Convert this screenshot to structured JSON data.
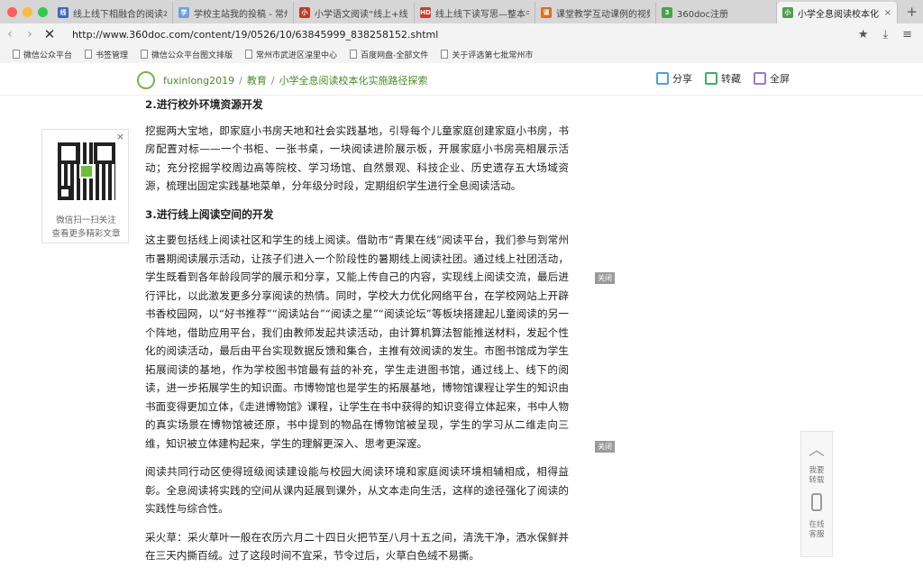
{
  "tabs": [
    {
      "label": "线上线下相融合的阅读本",
      "fav_color": "#3a66c4",
      "fav": "线"
    },
    {
      "label": "学校主站我的投稿 - 常州",
      "fav_color": "#6aa0e0",
      "fav": "学"
    },
    {
      "label": "小学语文阅读“线上+线下",
      "fav_color": "#c0392b",
      "fav": "小"
    },
    {
      "label": "线上线下读写思—整本书",
      "fav_color": "#d23a2b",
      "fav": "HD"
    },
    {
      "label": "课堂教学互动课例的视频",
      "fav_color": "#e06a1c",
      "fav": "课"
    },
    {
      "label": "360doc注册",
      "fav_color": "#4aa24a",
      "fav": "3"
    },
    {
      "label": "小学全息阅读校本化实施",
      "fav_color": "#4aa24a",
      "fav": "小",
      "close": "×"
    }
  ],
  "browser": {
    "url": "http://www.360doc.com/content/19/0526/10/63845999_838258152.shtml",
    "new_tab": "+"
  },
  "bookmarks": [
    "微信公众平台",
    "书签管理",
    "微信公众平台图文排版",
    "常州市武进区湟里中心",
    "百度网盘-全部文件",
    "关于评选第七批常州市"
  ],
  "site": {
    "user": "fuxinlong2019",
    "sep": "/",
    "category": "教育",
    "title": "小学全息阅读校本化实施路径探索",
    "share": "分享",
    "collect": "转藏",
    "fullscreen": "全屏"
  },
  "qr": {
    "close": "×",
    "line1": "微信扫一扫关注",
    "line2": "查看更多精彩文章"
  },
  "article": {
    "h1": "2.进行校外环境资源开发",
    "p1": "挖掘两大宝地，即家庭小书房天地和社会实践基地，引导每个儿童家庭创建家庭小书房，书房配置对标——一个书柜、一张书桌，一块阅读进阶展示板，开展家庭小书房亮相展示活动；充分挖掘学校周边高等院校、学习场馆、自然景观、科技企业、历史遗存五大场域资源，梳理出固定实践基地菜单，分年级分时段，定期组织学生进行全息阅读活动。",
    "h2": "3.进行线上阅读空间的开发",
    "p2": "这主要包括线上阅读社区和学生的线上阅读。借助市“青果在线”阅读平台，我们参与到常州市暑期阅读展示活动，让孩子们进入一个阶段性的暑期线上阅读社团。通过线上社团活动，学生既看到各年龄段同学的展示和分享，又能上传自己的内容，实现线上阅读交流，最后进行评比，以此激发更多分享阅读的热情。同时，学校大力优化网络平台，在学校网站上开辟书香校园网，以“好书推荐”“阅读站台”“阅读之星”“阅读论坛”等板块搭建起儿童阅读的另一个阵地，借助应用平台，我们由教师发起共读活动，由计算机算法智能推送材料，发起个性化的阅读活动，最后由平台实现数据反馈和集合，主推有效阅读的发生。市图书馆成为学生拓展阅读的基地，作为学校图书馆最有益的补充，学生走进图书馆，通过线上、线下的阅读，进一步拓展学生的知识面。市博物馆也是学生的拓展基地，博物馆课程让学生的知识由书面变得更加立体，《走进博物馆》课程，让学生在书中获得的知识变得立体起来，书中人物的真实场景在博物馆被还原，书中提到的物品在博物馆被呈现，学生的学习从二维走向三维，知识被立体建构起来，学生的理解更深入、思考更深邃。",
    "p3": "阅读共同行动区使得班级阅读建设能与校园大阅读环境和家庭阅读环境相辅相成，相得益彰。全息阅读将实践的空间从课内延展到课外，从文本走向生活，这样的途径强化了阅读的实践性与综合性。",
    "p4": "采火草：采火草叶一般在农历六月二十四日火把节至八月十五之间，清洗干净，洒水保鲜并在三天内撕百绒。过了这段时间不宜采，节令过后，火草白色绒不易撕。"
  },
  "close_tags": [
    "关闭",
    "关闭"
  ],
  "floatbar": {
    "up": "︿",
    "t1a": "我要",
    "t1b": "转载",
    "t2a": "在线",
    "t2b": "客服"
  }
}
